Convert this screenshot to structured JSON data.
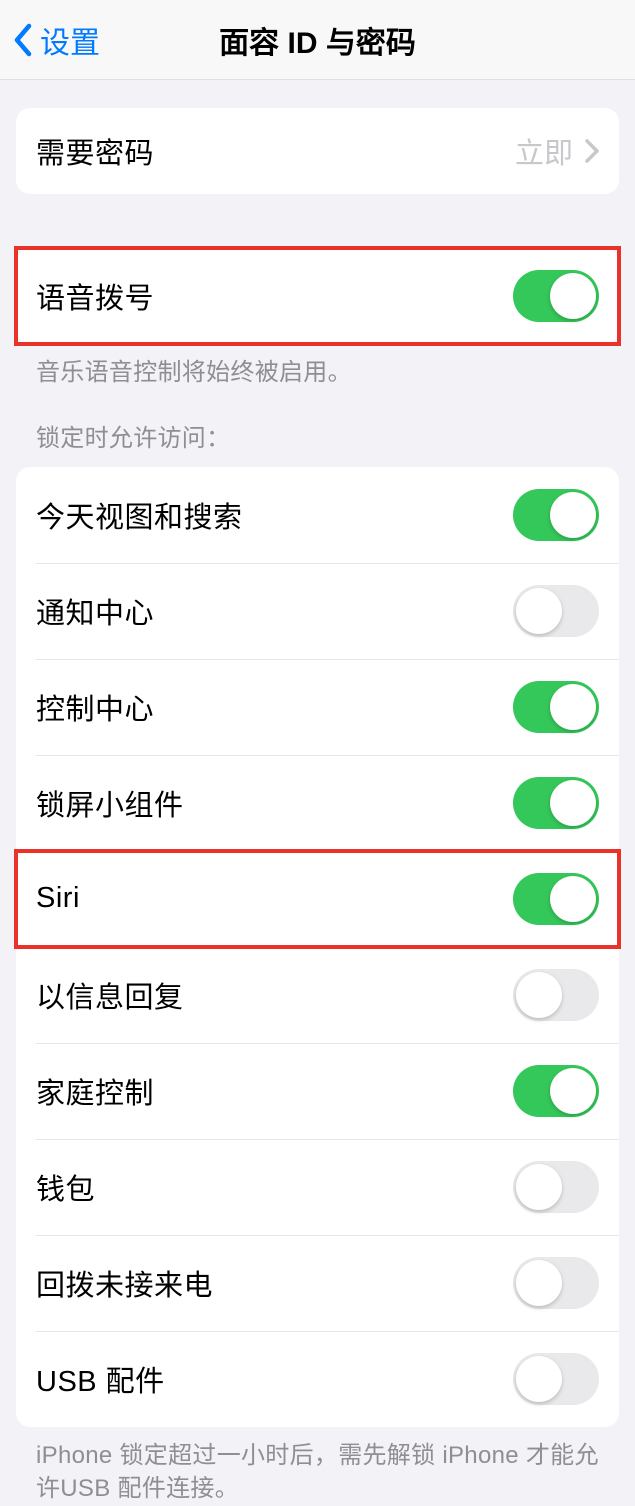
{
  "nav": {
    "back_label": "设置",
    "title": "面容 ID 与密码"
  },
  "require_passcode": {
    "label": "需要密码",
    "value": "立即"
  },
  "voice_dial": {
    "label": "语音拨号",
    "on": true,
    "footer": "音乐语音控制将始终被启用。"
  },
  "lock_access": {
    "header": "锁定时允许访问：",
    "items": [
      {
        "label": "今天视图和搜索",
        "on": true
      },
      {
        "label": "通知中心",
        "on": false
      },
      {
        "label": "控制中心",
        "on": true
      },
      {
        "label": "锁屏小组件",
        "on": true
      },
      {
        "label": "Siri",
        "on": true
      },
      {
        "label": "以信息回复",
        "on": false
      },
      {
        "label": "家庭控制",
        "on": true
      },
      {
        "label": "钱包",
        "on": false
      },
      {
        "label": "回拨未接来电",
        "on": false
      },
      {
        "label": "USB 配件",
        "on": false
      }
    ],
    "footer": "iPhone 锁定超过一小时后，需先解锁 iPhone 才能允许USB 配件连接。"
  }
}
